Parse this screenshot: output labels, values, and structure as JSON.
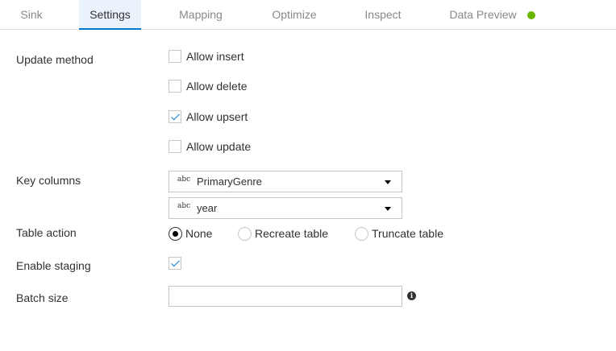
{
  "tabs": [
    {
      "label": "Sink",
      "active": false
    },
    {
      "label": "Settings",
      "active": true
    },
    {
      "label": "Mapping",
      "active": false
    },
    {
      "label": "Optimize",
      "active": false
    },
    {
      "label": "Inspect",
      "active": false
    },
    {
      "label": "Data Preview",
      "active": false
    }
  ],
  "data_preview_status_color": "#6bb700",
  "accent_color": "#0078d4",
  "update_method": {
    "label": "Update method",
    "options": [
      {
        "label": "Allow insert",
        "checked": false
      },
      {
        "label": "Allow delete",
        "checked": false
      },
      {
        "label": "Allow upsert",
        "checked": true
      },
      {
        "label": "Allow update",
        "checked": false
      }
    ]
  },
  "key_columns": {
    "label": "Key columns",
    "type_badge": "abc",
    "columns": [
      "PrimaryGenre",
      "year"
    ]
  },
  "table_action": {
    "label": "Table action",
    "options": [
      "None",
      "Recreate table",
      "Truncate table"
    ],
    "selected": "None"
  },
  "enable_staging": {
    "label": "Enable staging",
    "checked": true
  },
  "batch_size": {
    "label": "Batch size",
    "value": "",
    "info_icon": "info-icon",
    "info_glyph": "i"
  }
}
